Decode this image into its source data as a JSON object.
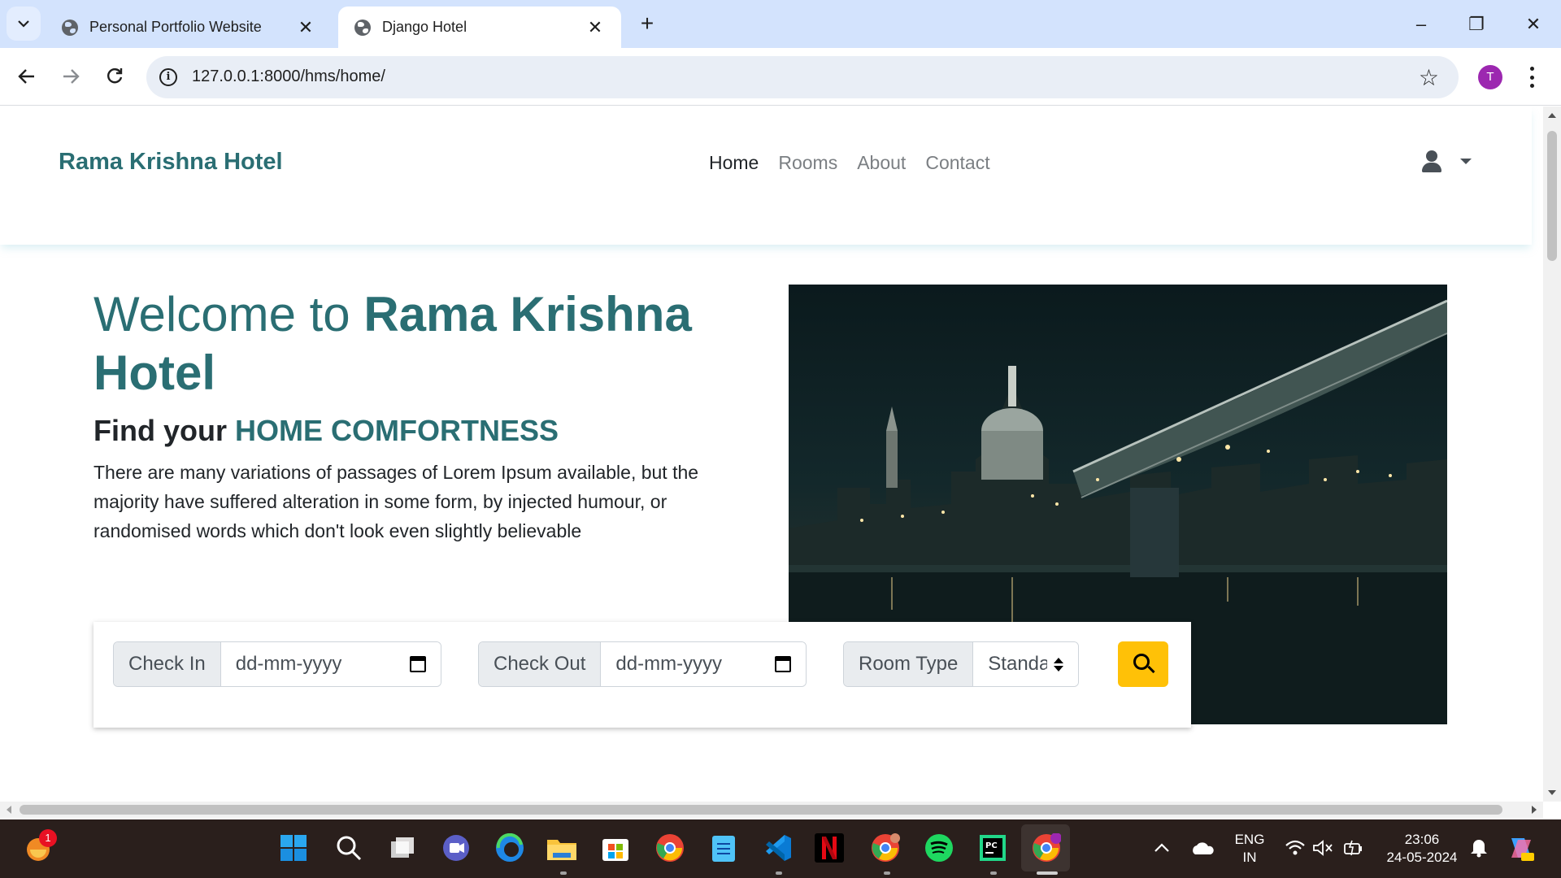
{
  "browser": {
    "tabs": [
      {
        "title": "Personal Portfolio Website",
        "active": false
      },
      {
        "title": "Django Hotel",
        "active": true
      }
    ],
    "url": "127.0.0.1:8000/hms/home/",
    "profile_initial": "T",
    "window_controls": {
      "minimize": "–",
      "restore": "❐",
      "close": "✕"
    }
  },
  "site": {
    "brand": "Rama Krishna Hotel",
    "nav": [
      {
        "label": "Home",
        "active": true
      },
      {
        "label": "Rooms",
        "active": false
      },
      {
        "label": "About",
        "active": false
      },
      {
        "label": "Contact",
        "active": false
      }
    ],
    "hero": {
      "title_prefix": "Welcome to ",
      "title_highlight": "Rama Krishna Hotel",
      "subtitle_prefix": "Find your ",
      "subtitle_highlight": "HOME COMFORTNESS",
      "description": "There are many variations of passages of Lorem Ipsum available, but the majority have suffered alteration in some form, by injected humour, or randomised words which don't look even slightly believable"
    },
    "booking": {
      "check_in_label": "Check In",
      "check_in_value": "dd-mm-yyyy",
      "check_out_label": "Check Out",
      "check_out_value": "dd-mm-yyyy",
      "room_type_label": "Room Type",
      "room_type_value": "Standaı"
    },
    "colors": {
      "brand": "#2a6e73",
      "search_button": "#ffc107"
    }
  },
  "taskbar": {
    "notification_badge": "1",
    "language": {
      "line1": "ENG",
      "line2": "IN"
    },
    "time": "23:06",
    "date": "24-05-2024"
  }
}
